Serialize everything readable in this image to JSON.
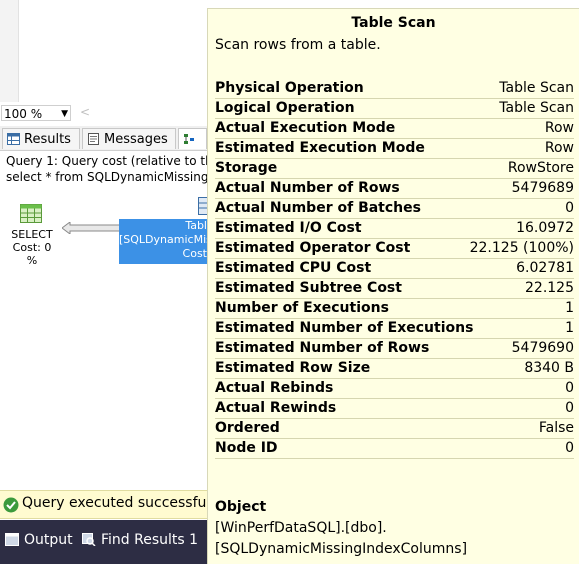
{
  "editor": {
    "zoom": "100 %",
    "scroll_left": "<"
  },
  "tabs": {
    "results": "Results",
    "messages": "Messages"
  },
  "plan": {
    "query_line": "Query 1: Query cost (relative to th",
    "sql_line": "select * from SQLDynamicMissing",
    "select_label": "SELECT",
    "select_cost": "Cost: 0 %",
    "scan_lines": [
      "Tabl",
      "[SQLDynamicMissi",
      "Cost"
    ]
  },
  "status": {
    "message": "Query executed successfully"
  },
  "bottom_tabs": {
    "output": "Output",
    "find_results": "Find Results 1"
  },
  "tooltip": {
    "title": "Table Scan",
    "description": "Scan rows from a table.",
    "properties": [
      {
        "name": "Physical Operation",
        "value": "Table Scan"
      },
      {
        "name": "Logical Operation",
        "value": "Table Scan"
      },
      {
        "name": "Actual Execution Mode",
        "value": "Row"
      },
      {
        "name": "Estimated Execution Mode",
        "value": "Row"
      },
      {
        "name": "Storage",
        "value": "RowStore"
      },
      {
        "name": "Actual Number of Rows",
        "value": "5479689"
      },
      {
        "name": "Actual Number of Batches",
        "value": "0"
      },
      {
        "name": "Estimated I/O Cost",
        "value": "16.0972"
      },
      {
        "name": "Estimated Operator Cost",
        "value": "22.125 (100%)"
      },
      {
        "name": "Estimated CPU Cost",
        "value": "6.02781"
      },
      {
        "name": "Estimated Subtree Cost",
        "value": "22.125"
      },
      {
        "name": "Number of Executions",
        "value": "1"
      },
      {
        "name": "Estimated Number of Executions",
        "value": "1"
      },
      {
        "name": "Estimated Number of Rows",
        "value": "5479690"
      },
      {
        "name": "Estimated Row Size",
        "value": "8340 B"
      },
      {
        "name": "Actual Rebinds",
        "value": "0"
      },
      {
        "name": "Actual Rewinds",
        "value": "0"
      },
      {
        "name": "Ordered",
        "value": "False"
      },
      {
        "name": "Node ID",
        "value": "0"
      }
    ],
    "object_heading": "Object",
    "object_lines": [
      "[WinPerfDataSQL].[dbo].",
      "[SQLDynamicMissingIndexColumns]"
    ]
  },
  "colors": {
    "tooltip_bg": "#ffffe3",
    "scan_highlight": "#3c91e6",
    "status_bg": "#fffbd0",
    "bottom_bar": "#2d2d44"
  }
}
